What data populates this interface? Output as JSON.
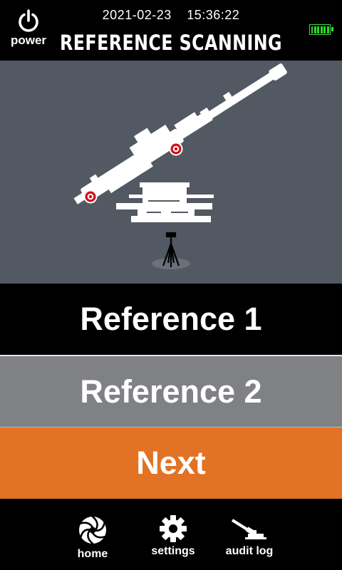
{
  "header": {
    "power_label": "power",
    "date": "2021-02-23",
    "time": "15:36:22",
    "title": "REFERENCE SCANNING",
    "battery_icon": "battery-full-icon",
    "battery_color": "#2fd62f"
  },
  "viewport": {
    "background": "#525963",
    "illustration": "howitzer-on-tripod",
    "target_marker_color": "#d0101c"
  },
  "buttons": {
    "reference1": "Reference 1",
    "reference2": "Reference 2",
    "next": "Next",
    "next_color": "#e27224",
    "reference2_color": "#808184"
  },
  "footer": {
    "items": [
      {
        "label": "home",
        "icon": "aperture-icon"
      },
      {
        "label": "settings",
        "icon": "gear-icon"
      },
      {
        "label": "audit log",
        "icon": "howitzer-icon"
      }
    ]
  }
}
